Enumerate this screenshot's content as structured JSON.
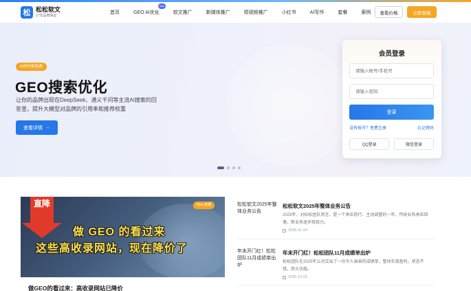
{
  "header": {
    "logo_mark": "松",
    "logo_name": "松松软文",
    "logo_sub": "17年品牌保证",
    "nav": [
      {
        "label": "首页",
        "badge": ""
      },
      {
        "label": "GEO AI优化",
        "badge": "new"
      },
      {
        "label": "软文推广",
        "badge": ""
      },
      {
        "label": "新媒体推广",
        "badge": ""
      },
      {
        "label": "短视频推广",
        "badge": ""
      },
      {
        "label": "小红书",
        "badge": ""
      },
      {
        "label": "AI写作",
        "badge": ""
      },
      {
        "label": "套餐",
        "badge": ""
      },
      {
        "label": "案例",
        "badge": ""
      }
    ],
    "price_button": "查看价格",
    "post_button": "立即发稿"
  },
  "hero": {
    "tag": "AI时代新机遇",
    "title": "GEO搜索优化",
    "desc": "让你的品牌出现在DeepSeek、通义千问等主流AI搜索的回答里，提升大模型对品牌的引用率和推荐权重",
    "button": "查看详情",
    "button_arrow": "→",
    "slide_count": 4,
    "active_slide": 1
  },
  "login": {
    "title": "会员登录",
    "username_placeholder": "请输入帐号/手机号",
    "password_placeholder": "请输入密码",
    "submit": "登录",
    "register": "没有帐号？免费注册",
    "forgot": "忘记密码",
    "qq": "QQ登录",
    "wechat": "微信登录"
  },
  "feature": {
    "arrow_text": "直降",
    "badge": "New 标题",
    "line1": "做 GEO 的看过来",
    "line2": "这些高收录网站，现在降价了",
    "caption": "做GEO的看过来：高收录网站已降价"
  },
  "news": [
    {
      "image_alt": "松松软文2025年整体业务公告",
      "title": "松松软文2025年整体业务公告",
      "desc": "2025年，对松松团队而言，是一个承压前行、主动调整的一年。传统业务承压回落，新业务逐步释放力。",
      "date": "2026-01-04"
    },
    {
      "image_alt": "年末开门红！松松团队11月成绩单出炉",
      "title": "年末开门红！松松团队11月成绩单出炉",
      "desc": "松松团队在2025年11月交出了一份令人振奋的成绩单，整体实现盈利，状态不错，势头也稳。",
      "date": "2025-12-01"
    }
  ],
  "colors": {
    "brand_blue": "#2677e8",
    "accent_orange": "#f5a623",
    "highlight_yellow": "#ffe14a",
    "arrow_red": "#e23a2a"
  }
}
